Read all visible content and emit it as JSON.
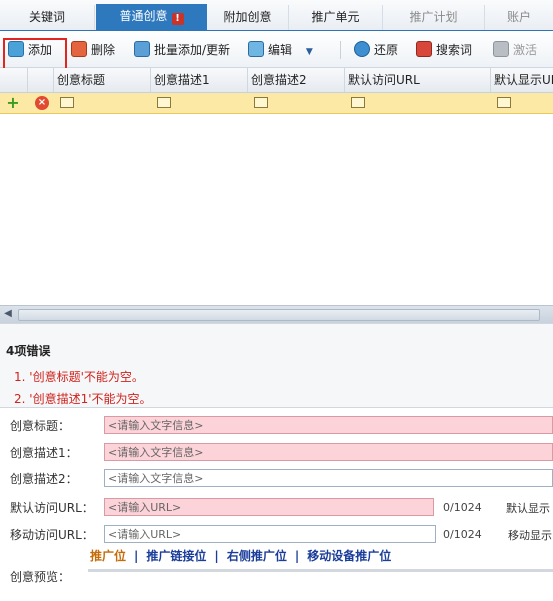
{
  "tabs": [
    {
      "label": "关键词"
    },
    {
      "label": "普通创意"
    },
    {
      "label": "附加创意"
    },
    {
      "label": "推广单元"
    },
    {
      "label": "推广计划"
    },
    {
      "label": "账户"
    }
  ],
  "tab_warning_glyph": "!",
  "toolbar": {
    "add": "添加",
    "delete": "删除",
    "batch": "批量添加/更新",
    "edit": "编辑",
    "restore": "还原",
    "search_words": "搜索词",
    "activate": "激活"
  },
  "grid": {
    "columns": [
      "创意标题",
      "创意描述1",
      "创意描述2",
      "默认访问URL",
      "默认显示URL"
    ]
  },
  "errors": {
    "title": "4项错误",
    "items": [
      "1. '创意标题'不能为空。",
      "2. '创意描述1'不能为空。"
    ]
  },
  "form": {
    "title_label": "创意标题：",
    "title_placeholder": "<请输入文字信息>",
    "desc1_label": "创意描述1：",
    "desc1_placeholder": "<请输入文字信息>",
    "desc2_label": "创意描述2：",
    "desc2_placeholder": "<请输入文字信息>",
    "visit_url_label": "默认访问URL：",
    "visit_url_placeholder": "<请输入URL>",
    "visit_url_count": "0/1024",
    "visit_url_side": "默认显示",
    "mobile_url_label": "移动访问URL：",
    "mobile_url_placeholder": "<请输入URL>",
    "mobile_url_count": "0/1024",
    "mobile_url_side": "移动显示",
    "preview_label": "创意预览："
  },
  "preview_links": [
    "推广位",
    "推广链接位",
    "右侧推广位",
    "移动设备推广位"
  ],
  "colors": {
    "tab_active": "#2e78bd",
    "error_text": "#d0231c",
    "edit_row": "#fde9a6",
    "invalid_input": "#fcd3d8",
    "highlight_box": "#e0261f"
  }
}
